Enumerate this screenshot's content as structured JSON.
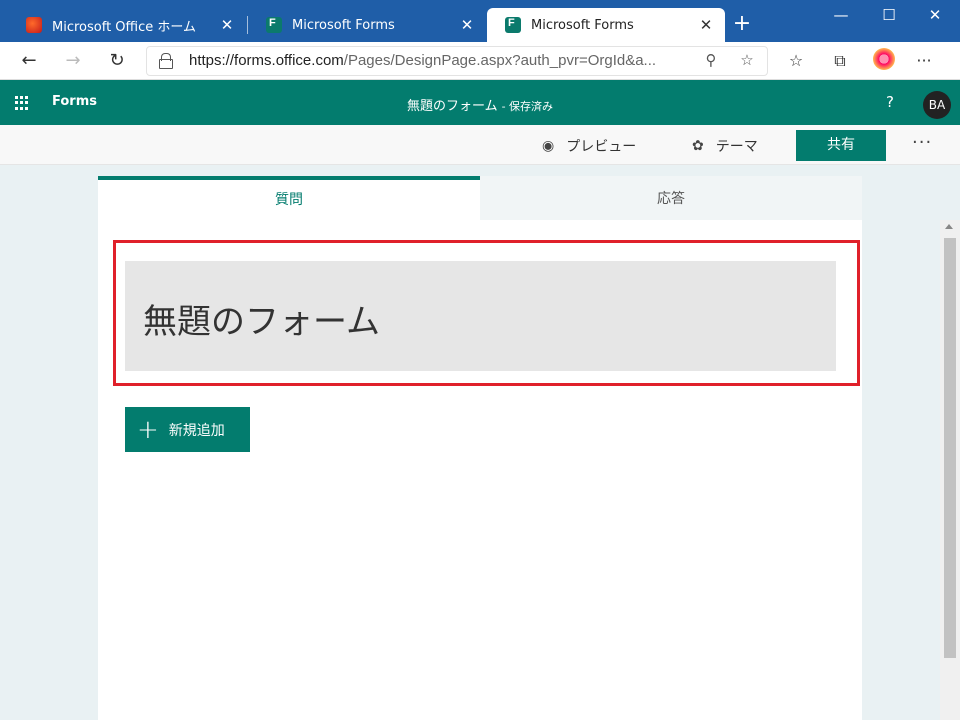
{
  "browser": {
    "tabs": [
      {
        "title": "Microsoft Office ホーム",
        "favicon": "office-icon"
      },
      {
        "title": "Microsoft Forms",
        "favicon": "forms-icon"
      },
      {
        "title": "Microsoft Forms",
        "favicon": "forms-icon"
      }
    ],
    "active_tab_index": 2,
    "url_host": "https://forms.office.com",
    "url_path": "/Pages/DesignPage.aspx?auth_pvr=OrgId&a...",
    "window_controls": {
      "minimize": "—",
      "maximize": "☐",
      "close": "✕"
    }
  },
  "appbar": {
    "app_name": "Forms",
    "doc_title": "無題のフォーム",
    "saved_status": "- 保存済み",
    "help": "?",
    "avatar_initials": "BA"
  },
  "commands": {
    "preview": "プレビュー",
    "theme": "テーマ",
    "share": "共有",
    "more": "···"
  },
  "form": {
    "tabs": [
      {
        "label": "質問",
        "active": true
      },
      {
        "label": "応答",
        "active": false
      }
    ],
    "title": "無題のフォーム",
    "add_new": "新規追加"
  },
  "colors": {
    "brand": "#037c6e",
    "browser_chrome": "#1f5ea8",
    "highlight": "#e0202a"
  }
}
